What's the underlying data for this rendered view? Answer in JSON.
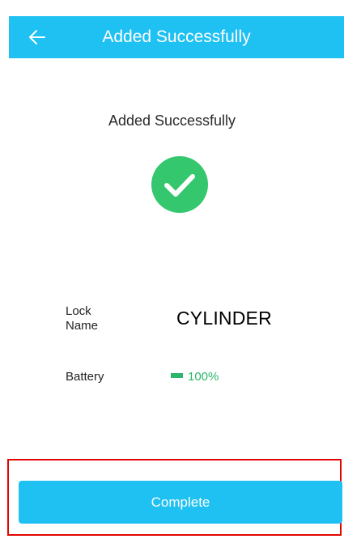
{
  "header": {
    "back_icon": "arrow-left-icon",
    "title": "Added Successfully"
  },
  "status": {
    "message": "Added Successfully",
    "icon": "check-circle-icon"
  },
  "lock": {
    "label": "Lock Name",
    "value": "CYLINDER"
  },
  "battery": {
    "label": "Battery",
    "value": "100%",
    "level": 1.0
  },
  "actions": {
    "complete_label": "Complete"
  },
  "colors": {
    "accent": "#1fc0f2",
    "success": "#2cb66b",
    "highlight_frame": "#e10600"
  }
}
